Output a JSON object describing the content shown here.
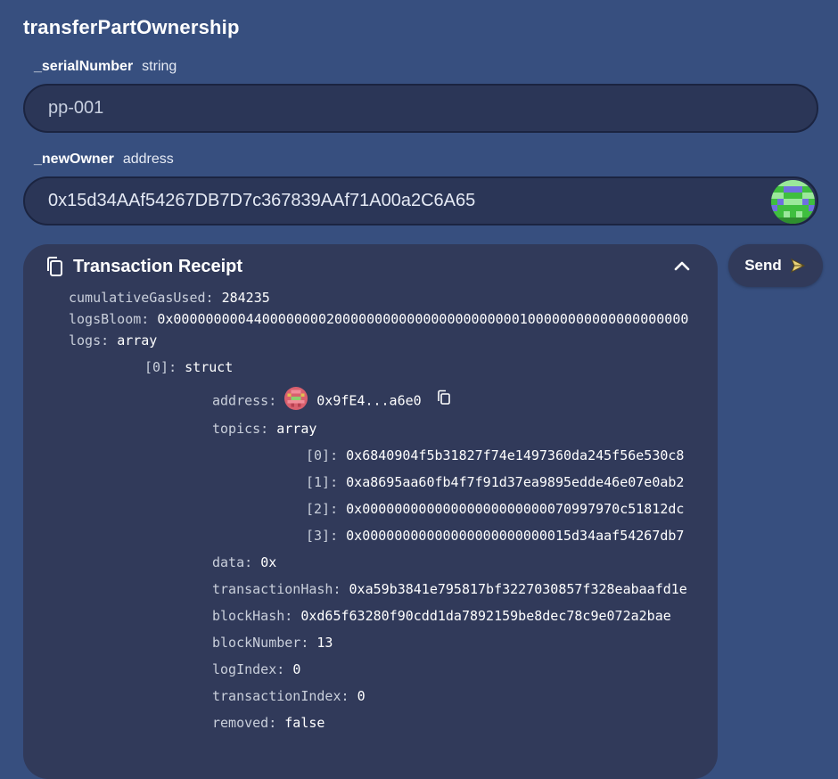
{
  "function": {
    "name": "transferPartOwnership"
  },
  "params": [
    {
      "name": "_serialNumber",
      "type": "string",
      "value": "pp-001"
    },
    {
      "name": "_newOwner",
      "type": "address",
      "value": "0x15d34AAf54267DB7D7c367839AAf71A00a2C6A65"
    }
  ],
  "send": {
    "label": "Send",
    "icon": "send-icon"
  },
  "receipt": {
    "title": "Transaction Receipt",
    "cumulativeGasUsed": {
      "key": "cumulativeGasUsed:",
      "value": "284235"
    },
    "logsBloom": {
      "key": "logsBloom:",
      "value": "0x0000000004400000000200000000000000000000000100000000000000000000"
    },
    "logs": {
      "key": "logs:",
      "value": "array"
    },
    "log0": {
      "index": "[0]:",
      "value": "struct",
      "address": {
        "key": "address:",
        "value": "0x9fE4...a6e0"
      },
      "topics": {
        "key": "topics:",
        "value": "array"
      },
      "topic_items": [
        {
          "index": "[0]:",
          "value": "0x6840904f5b31827f74e1497360da245f56e530c8"
        },
        {
          "index": "[1]:",
          "value": "0xa8695aa60fb4f7f91d37ea9895edde46e07e0ab2"
        },
        {
          "index": "[2]:",
          "value": "0x00000000000000000000000070997970c51812dc"
        },
        {
          "index": "[3]:",
          "value": "0x00000000000000000000000015d34aaf54267db7"
        }
      ],
      "data": {
        "key": "data:",
        "value": "0x"
      },
      "transactionHash": {
        "key": "transactionHash:",
        "value": "0xa59b3841e795817bf3227030857f328eabaafd1e"
      },
      "blockHash": {
        "key": "blockHash:",
        "value": "0xd65f63280f90cdd1da7892159be8dec78c9e072a2bae"
      },
      "blockNumber": {
        "key": "blockNumber:",
        "value": "13"
      },
      "logIndex": {
        "key": "logIndex:",
        "value": "0"
      },
      "transactionIndex": {
        "key": "transactionIndex:",
        "value": "0"
      },
      "removed": {
        "key": "removed:",
        "value": "false"
      }
    }
  },
  "colors": {
    "background": "#374f7f",
    "panel": "#313a5a",
    "input": "#2b3657"
  }
}
